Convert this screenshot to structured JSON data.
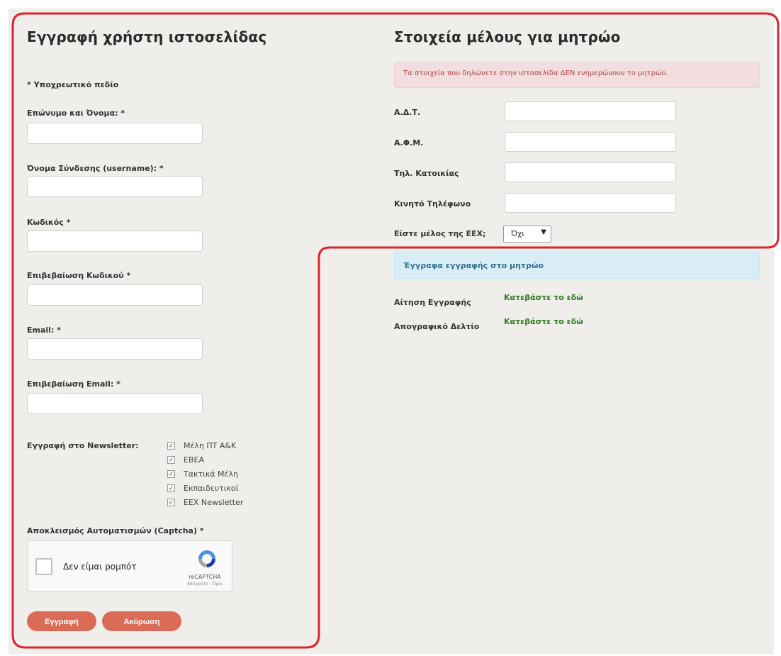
{
  "left": {
    "title": "Εγγραφή χρήστη ιστοσελίδας",
    "required_note": "* Υποχρεωτικό πεδίο",
    "fields": [
      {
        "label": "Επώνυμο και Όνομα: *",
        "value": ""
      },
      {
        "label": "Όνομα Σύνδεσης (username): *",
        "value": ""
      },
      {
        "label": "Κωδικός *",
        "value": ""
      },
      {
        "label": "Επιβεβαίωση Κωδικού *",
        "value": ""
      },
      {
        "label": "Email: *",
        "value": ""
      },
      {
        "label": "Επιβεβαίωση Email: *",
        "value": ""
      }
    ],
    "newsletter_label": "Εγγραφή στο Newsletter:",
    "newsletter_options": [
      {
        "label": "Μέλη ΠΤ Α&Κ",
        "checked": true
      },
      {
        "label": "ΕΒΕΑ",
        "checked": true
      },
      {
        "label": "Τακτικά Μέλη",
        "checked": true
      },
      {
        "label": "Εκπαιδευτικοί",
        "checked": true
      },
      {
        "label": "ΕΕΧ Newsletter",
        "checked": true
      }
    ],
    "captcha_label": "Αποκλεισμός Αυτοματισμών (Captcha) *",
    "captcha_text": "Δεν είμαι ρομπότ",
    "captcha_brand": "reCAPTCHA",
    "captcha_terms": "Απόρρητο - Όροι",
    "buttons": {
      "submit": "Εγγραφή",
      "cancel": "Ακύρωση"
    }
  },
  "right": {
    "title": "Στοιχεία μέλους για μητρώο",
    "warning": "Τα στοιχεία που δηλώνετε στην ιστοσελίδα ΔΕΝ ενημερώνουν το μητρώο.",
    "fields": [
      {
        "label": "Α.Δ.Τ.",
        "value": ""
      },
      {
        "label": "Α.Φ.Μ.",
        "value": ""
      },
      {
        "label": "Τηλ. Κατοικίας",
        "value": ""
      },
      {
        "label": "Κινητό Τηλέφωνο",
        "value": ""
      }
    ],
    "member_label": "Είστε μέλος της ΕΕΧ;",
    "member_value": "Όχι",
    "docs_header": "Έγγραφα εγγραφής στο μητρώο",
    "docs": [
      {
        "label": "Αίτηση Εγγραφής",
        "link": "Κατεβάστε το εδώ"
      },
      {
        "label": "Απογραφικό Δελτίο",
        "link": "Κατεβάστε το εδώ"
      }
    ]
  },
  "colors": {
    "panel_bg": "#efeeea",
    "highlight_outline": "#d9262e",
    "button_bg": "#d96b57",
    "link_green": "#2e7d1f",
    "alert_red_bg": "#f2dede",
    "alert_blue_bg": "#d9edf7"
  },
  "icons": [
    "checkbox-checked-icon",
    "recaptcha-logo-icon",
    "dropdown-arrow-icon"
  ]
}
